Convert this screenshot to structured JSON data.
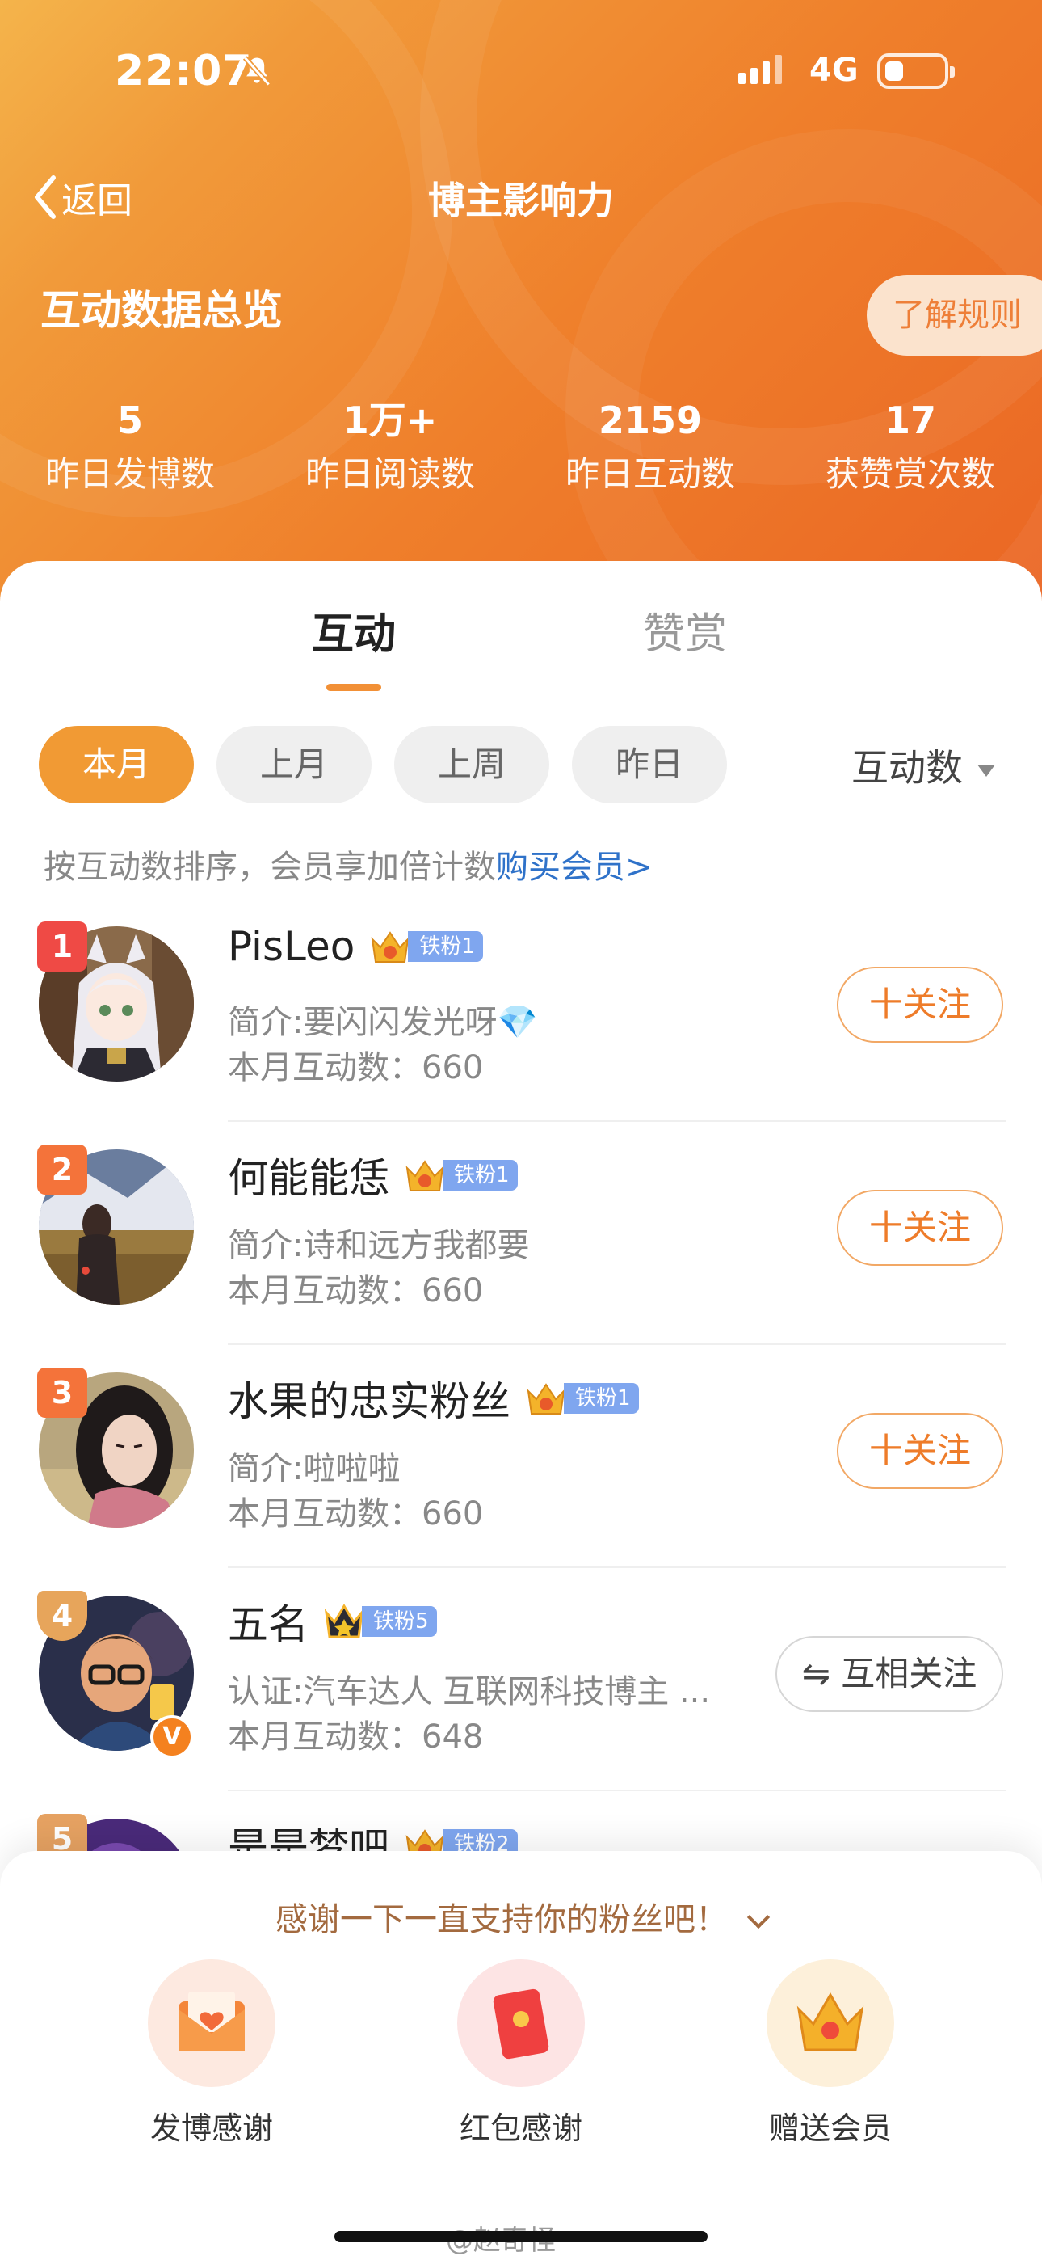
{
  "status_bar": {
    "time": "22:07",
    "network": "4G"
  },
  "nav": {
    "back_label": "返回",
    "title": "博主影响力"
  },
  "overview": {
    "title": "互动数据总览",
    "rules_label": "了解规则",
    "stats": [
      {
        "value": "5",
        "label": "昨日发博数"
      },
      {
        "value": "1万+",
        "label": "昨日阅读数"
      },
      {
        "value": "2159",
        "label": "昨日互动数"
      },
      {
        "value": "17",
        "label": "获赞赏次数"
      }
    ]
  },
  "tabs": [
    {
      "label": "互动",
      "active": true
    },
    {
      "label": "赞赏",
      "active": false
    }
  ],
  "filters": {
    "options": [
      {
        "label": "本月",
        "active": true
      },
      {
        "label": "上月",
        "active": false
      },
      {
        "label": "上周",
        "active": false
      },
      {
        "label": "昨日",
        "active": false
      }
    ],
    "sort_label": "互动数"
  },
  "hint": {
    "text": "按互动数排序，会员享加倍计数",
    "link": "购买会员>"
  },
  "fans": [
    {
      "rank": "1",
      "name": "PisLeo",
      "fan_level": "铁粉1",
      "crown_num": "4",
      "intro": "简介:要闪闪发光呀💎",
      "count": "本月互动数：660",
      "action": "十关注"
    },
    {
      "rank": "2",
      "name": "何能能恁",
      "fan_level": "铁粉1",
      "crown_num": "5",
      "intro": "简介:诗和远方我都要",
      "count": "本月互动数：660",
      "action": "十关注"
    },
    {
      "rank": "3",
      "name": "水果的忠实粉丝",
      "fan_level": "铁粉1",
      "crown_num": "4",
      "intro": "简介:啦啦啦",
      "count": "本月互动数：660",
      "action": "十关注"
    },
    {
      "rank": "4",
      "name": "五名",
      "fan_level": "铁粉5",
      "crown_num": "",
      "intro": "认证:汽车达人 互联网科技博主 ...",
      "count": "本月互动数：648",
      "action": "⇋ 互相关注",
      "verified": "V"
    },
    {
      "rank": "5",
      "name": "是是梦吧",
      "fan_level": "铁粉2",
      "crown_num": "",
      "intro": "",
      "count": "",
      "action": ""
    }
  ],
  "thanks_sheet": {
    "title": "感谢一下一直支持你的粉丝吧！",
    "actions": [
      {
        "label": "发博感谢",
        "icon": "envelope-heart-icon"
      },
      {
        "label": "红包感谢",
        "icon": "red-packet-icon"
      },
      {
        "label": "赠送会员",
        "icon": "crown-icon"
      }
    ]
  },
  "watermark": "@赵奇怪",
  "colors": {
    "accent": "#f19a34",
    "follow": "#ee7c2a",
    "link": "#2f72c9",
    "fan_badge": "#7fa6ef"
  }
}
